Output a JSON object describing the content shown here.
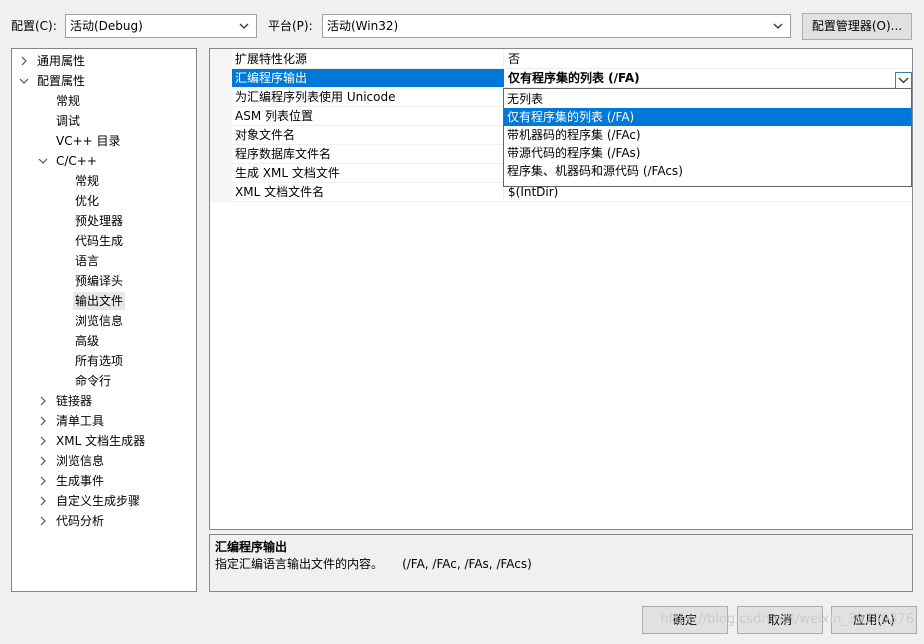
{
  "toolbar": {
    "config_label": "配置(C):",
    "config_value": "活动(Debug)",
    "platform_label": "平台(P):",
    "platform_value": "活动(Win32)",
    "config_manager_label": "配置管理器(O)..."
  },
  "tree": {
    "items": [
      {
        "label": "通用属性",
        "expander": "chevron-right"
      },
      {
        "label": "配置属性",
        "expander": "chevron-down"
      },
      {
        "label": "常规"
      },
      {
        "label": "调试"
      },
      {
        "label": "VC++ 目录"
      },
      {
        "label": "C/C++",
        "expander": "chevron-down"
      },
      {
        "label": "常规"
      },
      {
        "label": "优化"
      },
      {
        "label": "预处理器"
      },
      {
        "label": "代码生成"
      },
      {
        "label": "语言"
      },
      {
        "label": "预编译头"
      },
      {
        "label": "输出文件",
        "selected": true
      },
      {
        "label": "浏览信息"
      },
      {
        "label": "高级"
      },
      {
        "label": "所有选项"
      },
      {
        "label": "命令行"
      },
      {
        "label": "链接器",
        "expander": "chevron-right"
      },
      {
        "label": "清单工具",
        "expander": "chevron-right"
      },
      {
        "label": "XML 文档生成器",
        "expander": "chevron-right"
      },
      {
        "label": "浏览信息",
        "expander": "chevron-right"
      },
      {
        "label": "生成事件",
        "expander": "chevron-right"
      },
      {
        "label": "自定义生成步骤",
        "expander": "chevron-right"
      },
      {
        "label": "代码分析",
        "expander": "chevron-right"
      }
    ]
  },
  "properties": [
    {
      "name": "扩展特性化源",
      "value": "否"
    },
    {
      "name": "汇编程序输出",
      "value": "仅有程序集的列表 (/FA)",
      "selected": true
    },
    {
      "name": "为汇编程序列表使用 Unicode",
      "value": ""
    },
    {
      "name": "ASM 列表位置",
      "value": ""
    },
    {
      "name": "对象文件名",
      "value": ""
    },
    {
      "name": "程序数据库文件名",
      "value": ""
    },
    {
      "name": "生成 XML 文档文件",
      "value": ""
    },
    {
      "name": "XML 文档文件名",
      "value": "$(IntDir)"
    }
  ],
  "dropdown": {
    "options": [
      "无列表",
      "仅有程序集的列表 (/FA)",
      "带机器码的程序集 (/FAc)",
      "带源代码的程序集 (/FAs)",
      "程序集、机器码和源代码 (/FAcs)"
    ],
    "highlighted_index": 1
  },
  "description": {
    "title": "汇编程序输出",
    "text": "指定汇编语言输出文件的内容。     (/FA, /FAc, /FAs, /FAcs)"
  },
  "buttons": {
    "ok": "确定",
    "cancel": "取消",
    "apply": "应用(A)"
  },
  "watermark": "https://blog.csdn.net/weixin_39730376",
  "colors": {
    "selection": "#0078d7",
    "background": "#f0f0f0"
  }
}
